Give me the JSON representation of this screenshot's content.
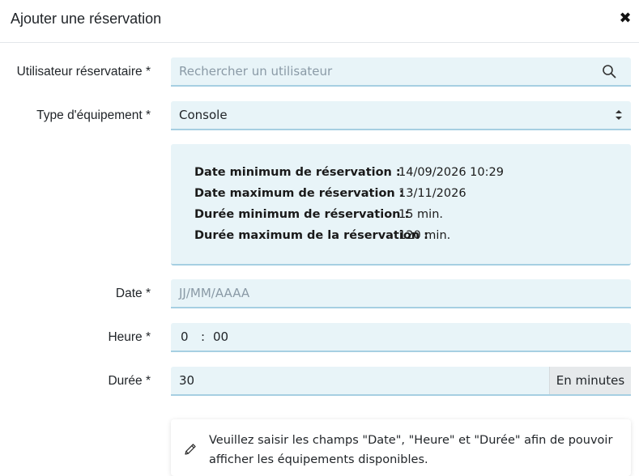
{
  "modal": {
    "title": "Ajouter une réservation",
    "close_icon": "close-icon",
    "close_glyph": "✖"
  },
  "user_field": {
    "label": "Utilisateur réservataire *",
    "placeholder": "Rechercher un utilisateur",
    "icon": "search-icon"
  },
  "equipment_type": {
    "label": "Type d'équipement *",
    "selected": "Console",
    "icon": "chevron-updown-icon"
  },
  "info": {
    "rows": [
      {
        "label": "Date minimum de réservation :",
        "value": "14/09/2026 10:29"
      },
      {
        "label": "Date maximum de réservation :",
        "value": "13/11/2026"
      },
      {
        "label": "Durée minimum de réservation :",
        "value": "15 min."
      },
      {
        "label": "Durée maximum de la réservation :",
        "value": "120 min."
      }
    ]
  },
  "date_field": {
    "label": "Date *",
    "placeholder": "JJ/MM/AAAA"
  },
  "time_field": {
    "label": "Heure *",
    "hours": "0",
    "separator": ":",
    "minutes": "00"
  },
  "duration_field": {
    "label": "Durée *",
    "value": "30",
    "addon": "En minutes"
  },
  "alert": {
    "icon": "pencil-icon",
    "text": "Veuillez saisir les champs \"Date\", \"Heure\" et \"Durée\" afin de pouvoir afficher les équipements disponibles."
  },
  "colors": {
    "field_bg": "#e8f4f8",
    "field_border": "#a6cfe2",
    "addon_bg": "#e6e9eb"
  }
}
